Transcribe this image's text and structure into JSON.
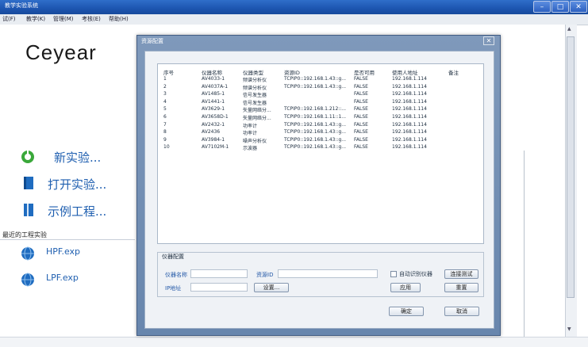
{
  "window": {
    "title": "教学实验系统",
    "controls": {
      "minimize": "–",
      "maximize": "□",
      "close": "✕"
    }
  },
  "menu": [
    "试(F)",
    "教学(K)",
    "管理(M)",
    "考核(E)",
    "帮助(H)"
  ],
  "logo": "Ceyear",
  "left_panel": {
    "actions": [
      {
        "label": "新实验...",
        "icon": "new-experiment-icon",
        "color": "#3aa83a"
      },
      {
        "label": "打开实验...",
        "icon": "open-book-icon",
        "color": "#1f6cc0"
      },
      {
        "label": "示例工程...",
        "icon": "example-book-icon",
        "color": "#1f6cc0"
      }
    ],
    "recent_heading": "最近的工程实验",
    "recent": [
      {
        "label": "HPF.exp",
        "icon": "globe-icon"
      },
      {
        "label": "LPF.exp",
        "icon": "globe-icon"
      }
    ]
  },
  "dialog": {
    "title": "资源配置",
    "close": "✕",
    "table": {
      "headers": [
        "序号",
        "仪器名称",
        "仪器类型",
        "资源ID",
        "是否可用",
        "使用人地址",
        "备注"
      ],
      "rows": [
        [
          "1",
          "AV4033-1",
          "频谱分析仪",
          "TCPIP0::192.168.1.43::g...",
          "FALSE",
          "192.168.1.114",
          ""
        ],
        [
          "2",
          "AV4037A-1",
          "频谱分析仪",
          "TCPIP0::192.168.1.43::g...",
          "FALSE",
          "192.168.1.114",
          ""
        ],
        [
          "3",
          "AV1485-1",
          "信号发生器",
          "",
          "FALSE",
          "192.168.1.114",
          ""
        ],
        [
          "4",
          "AV1441-1",
          "信号发生器",
          "",
          "FALSE",
          "192.168.1.114",
          ""
        ],
        [
          "5",
          "AV3629-1",
          "矢量网络分...",
          "TCPIP0::192.168.1.212::...",
          "FALSE",
          "192.168.1.114",
          ""
        ],
        [
          "6",
          "AV3658D-1",
          "矢量网络分...",
          "TCPIP0::192.168.1.11::1...",
          "FALSE",
          "192.168.1.114",
          ""
        ],
        [
          "7",
          "AV2432-1",
          "功率计",
          "TCPIP0::192.168.1.43::g...",
          "FALSE",
          "192.168.1.114",
          ""
        ],
        [
          "8",
          "AV2436",
          "功率计",
          "TCPIP0::192.168.1.43::g...",
          "FALSE",
          "192.168.1.114",
          ""
        ],
        [
          "9",
          "AV3984-1",
          "噪声分析仪",
          "TCPIP0::192.168.1.43::g...",
          "FALSE",
          "192.168.1.114",
          ""
        ],
        [
          "10",
          "AV7102M-1",
          "示波器",
          "TCPIP0::192.168.1.43::g...",
          "FALSE",
          "192.168.1.114",
          ""
        ]
      ]
    },
    "config": {
      "title": "仪器配置",
      "instrument_name_label": "仪器名称",
      "instrument_name_value": "",
      "resource_id_label": "资源ID",
      "resource_id_value": "",
      "ip_label": "IP地址",
      "ip_value": "",
      "settings_button": "设置...",
      "auto_detect_label": "自动识别仪器",
      "auto_detect_checked": false,
      "connect_test_button": "连接测试",
      "apply_button": "应用",
      "reset_button": "重置"
    },
    "ok_button": "确定",
    "cancel_button": "取消"
  }
}
